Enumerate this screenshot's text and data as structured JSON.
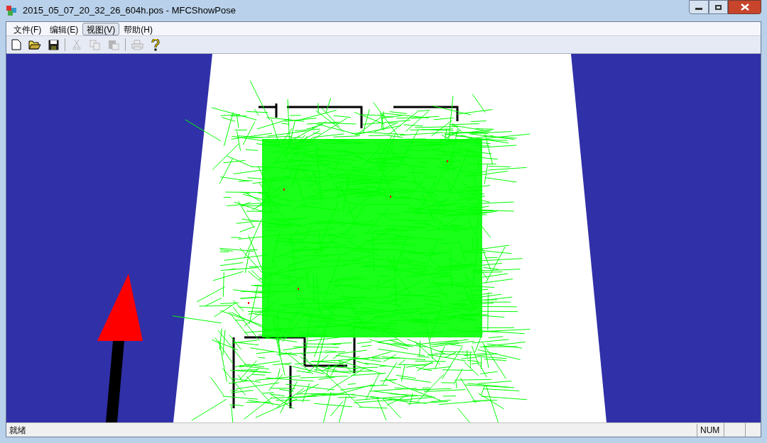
{
  "window": {
    "title": "2015_05_07_20_32_26_604h.pos - MFCShowPose"
  },
  "menu": [
    {
      "label": "文件(F)",
      "selected": false
    },
    {
      "label": "编辑(E)",
      "selected": false
    },
    {
      "label": "视图(V)",
      "selected": true
    },
    {
      "label": "帮助(H)",
      "selected": false
    }
  ],
  "toolbar": [
    {
      "kind": "new",
      "disabled": false
    },
    {
      "kind": "open",
      "disabled": false
    },
    {
      "kind": "save",
      "disabled": false
    },
    {
      "kind": "sep"
    },
    {
      "kind": "cut",
      "disabled": true
    },
    {
      "kind": "copy",
      "disabled": true
    },
    {
      "kind": "paste",
      "disabled": true
    },
    {
      "kind": "sep"
    },
    {
      "kind": "print",
      "disabled": true
    },
    {
      "kind": "help",
      "disabled": false
    }
  ],
  "status_bar": {
    "message": "就绪",
    "indicators": [
      "NUM"
    ]
  }
}
